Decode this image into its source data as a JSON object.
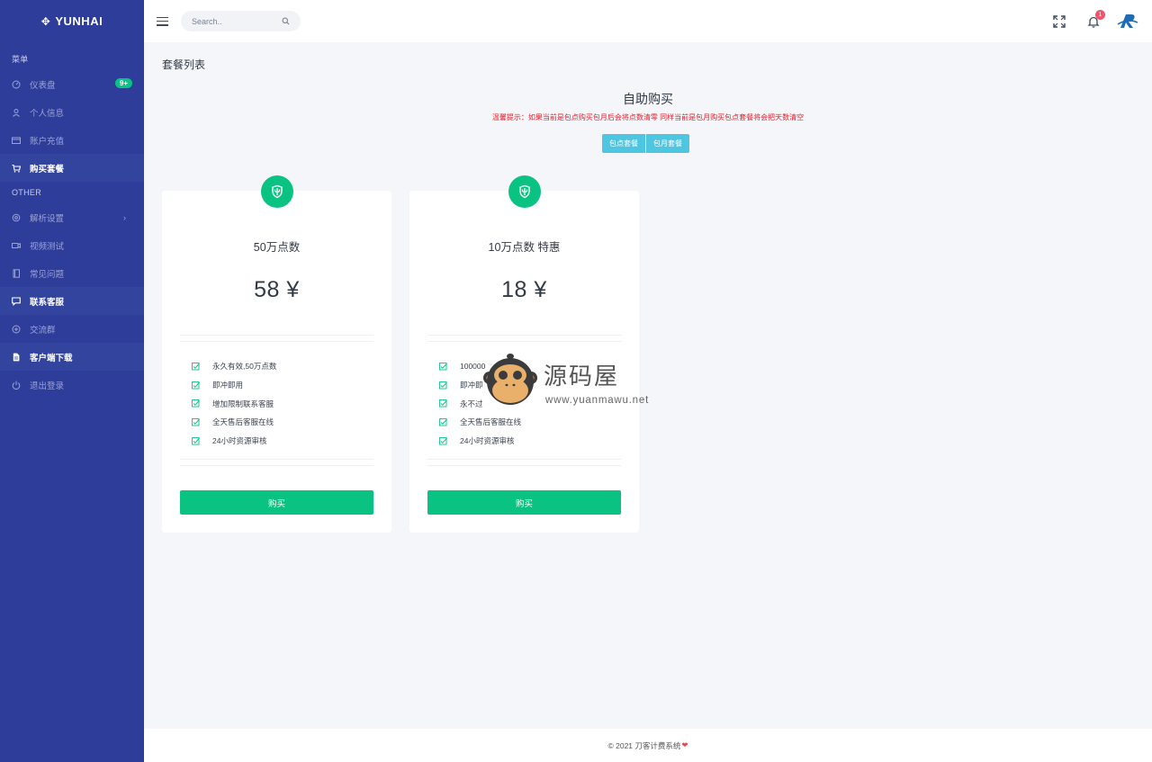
{
  "brand": {
    "name": "YUNHAI",
    "icon": "crosshair-icon"
  },
  "sidebar": {
    "section_menu": "菜单",
    "section_other": "OTHER",
    "items_main": [
      {
        "label": "仪表盘",
        "icon": "dashboard-icon",
        "badge": "9+"
      },
      {
        "label": "个人信息",
        "icon": "user-icon"
      },
      {
        "label": "账户充值",
        "icon": "card-icon"
      },
      {
        "label": "购买套餐",
        "icon": "cart-icon",
        "active": true
      }
    ],
    "items_other": [
      {
        "label": "解析设置",
        "icon": "settings-icon",
        "has_submenu": true
      },
      {
        "label": "视频测试",
        "icon": "video-icon"
      },
      {
        "label": "常见问题",
        "icon": "book-icon"
      },
      {
        "label": "联系客服",
        "icon": "message-icon"
      },
      {
        "label": "交流群",
        "icon": "plus-circle-icon"
      },
      {
        "label": "客户端下载",
        "icon": "file-icon"
      },
      {
        "label": "退出登录",
        "icon": "power-icon"
      }
    ]
  },
  "topbar": {
    "search_placeholder": "Search..",
    "notification_count": "1"
  },
  "main": {
    "page_title": "套餐列表",
    "buy_title": "自助购买",
    "notice": "温馨提示：如果当前是包点购买包月后会将点数清零 同样当前是包月购买包点套餐将会把天数清空",
    "tabs": [
      "包点套餐",
      "包月套餐"
    ]
  },
  "plans": [
    {
      "name": "50万点数",
      "price": "58 ¥",
      "features": [
        "永久有效,50万点数",
        "即冲即用",
        "增加限制联系客服",
        "全天售后客服在线",
        "24小时资源审核"
      ],
      "button": "购买"
    },
    {
      "name": "10万点数 特惠",
      "price": "18 ¥",
      "features": [
        "100000",
        "即冲即",
        "永不过",
        "全天售后客服在线",
        "24小时资源审核"
      ],
      "button": "购买"
    }
  ],
  "watermark": {
    "name": "源码屋",
    "url": "www.yuanmawu.net"
  },
  "footer": {
    "text": "© 2021 刀客计费系统"
  },
  "colors": {
    "sidebar": "#2e3d99",
    "accent_green": "#0ac282",
    "tab_blue": "#4fc6e1",
    "notice_red": "#e4202c"
  }
}
